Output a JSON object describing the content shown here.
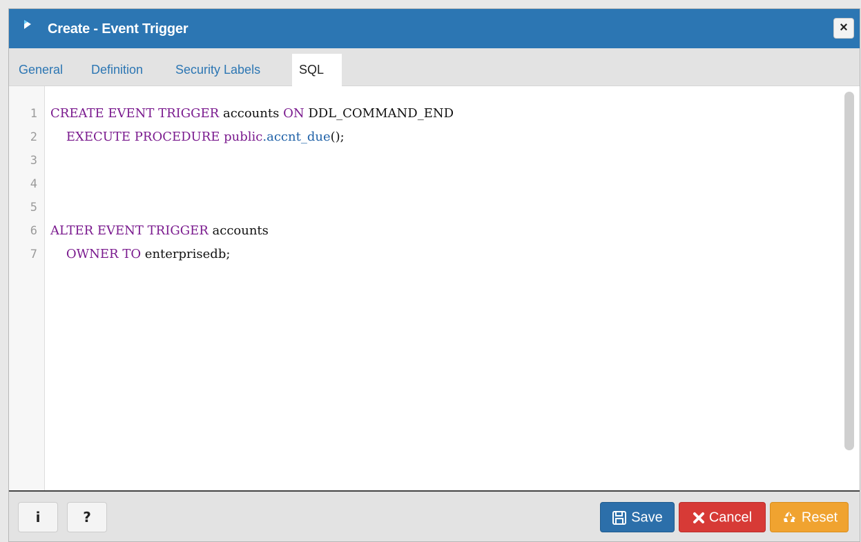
{
  "dialog": {
    "title": "Create - Event Trigger",
    "close_label": "×"
  },
  "tabs": [
    {
      "label": "General",
      "active": false
    },
    {
      "label": "Definition",
      "active": false
    },
    {
      "label": "Security Labels",
      "active": false
    },
    {
      "label": "SQL",
      "active": true
    }
  ],
  "editor": {
    "line_numbers": [
      "1",
      "2",
      "3",
      "4",
      "5",
      "6",
      "7"
    ],
    "lines": [
      {
        "kw1": "CREATE EVENT TRIGGER",
        "t1": " accounts ",
        "kw2": "ON",
        "t2": " DDL_COMMAND_END"
      },
      {
        "indent": "    ",
        "kw1": "EXECUTE PROCEDURE",
        "t1": " ",
        "kw2": "public",
        "fn": ".accnt_due",
        "t2": "();"
      },
      {},
      {},
      {},
      {
        "kw1": "ALTER EVENT TRIGGER",
        "t1": " accounts"
      },
      {
        "indent": "    ",
        "kw1": "OWNER TO",
        "t1": " enterprisedb;"
      }
    ]
  },
  "footer": {
    "info_label": "i",
    "help_label": "?",
    "save_label": "Save",
    "cancel_label": "Cancel",
    "reset_label": "Reset"
  },
  "colors": {
    "titlebar": "#2c76b3",
    "keyword": "#7a1a8e",
    "function": "#2062a8",
    "save": "#2c6faa",
    "cancel": "#d73a36",
    "reset": "#f0a330"
  },
  "icons": {
    "app": "pgadmin-elephant-icon",
    "close": "close-icon",
    "save": "floppy-disk-icon",
    "cancel": "x-icon",
    "reset": "recycle-icon"
  }
}
